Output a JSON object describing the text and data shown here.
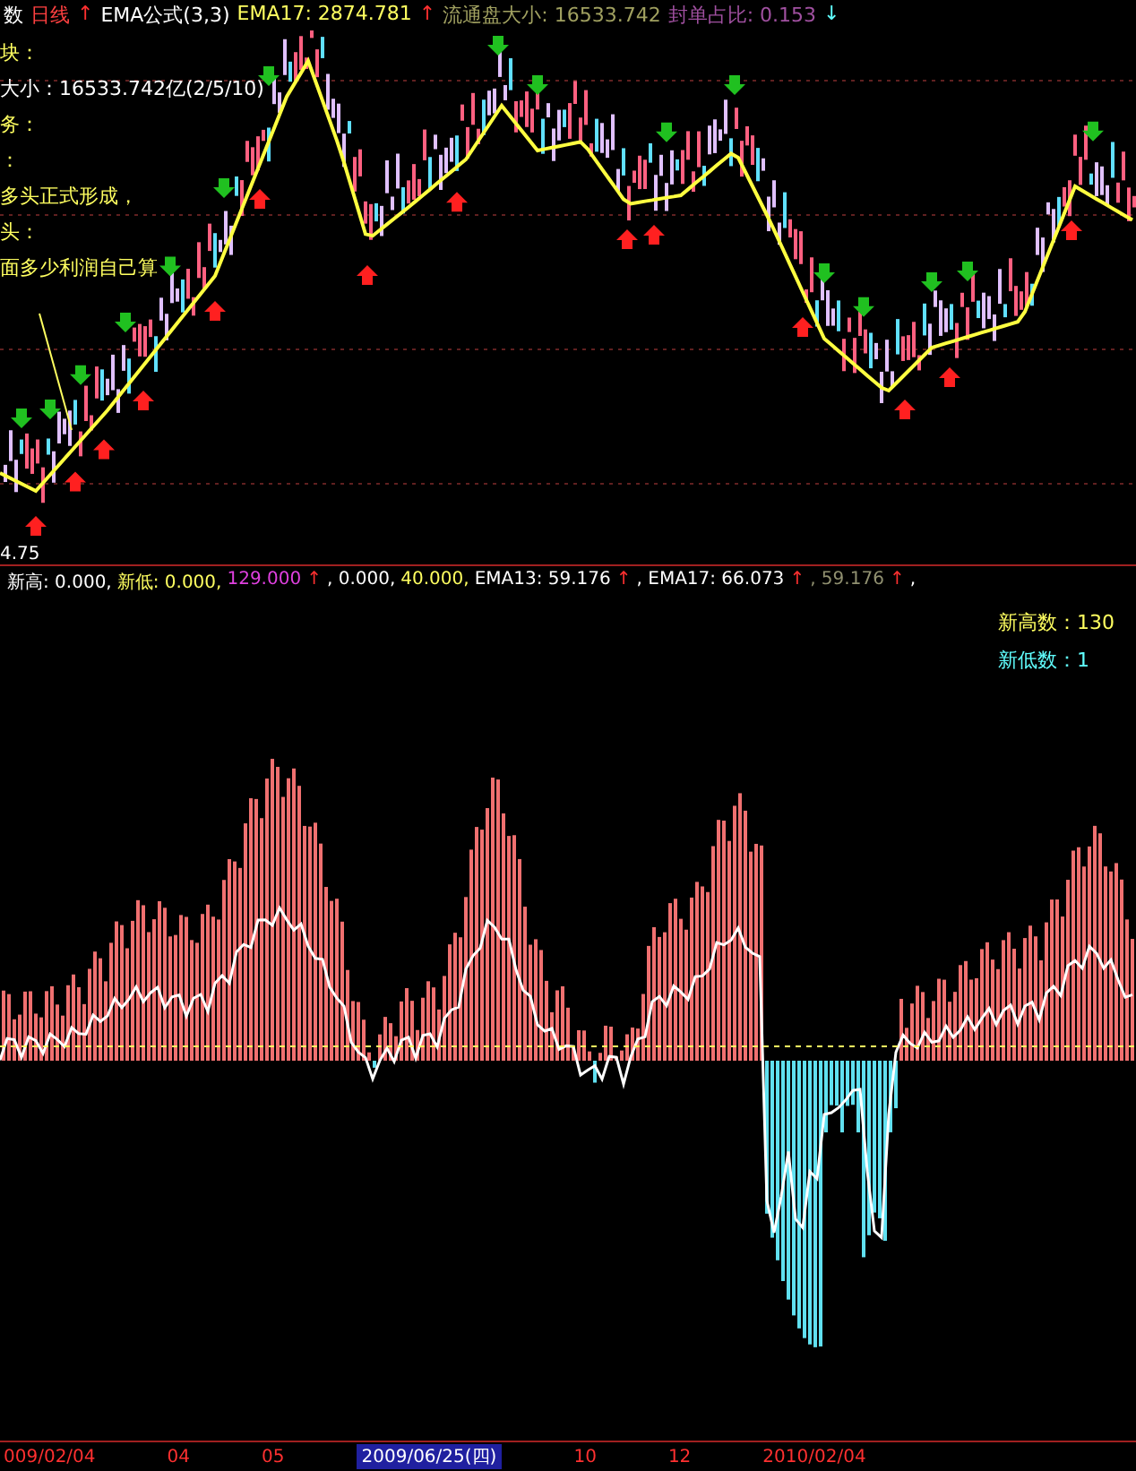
{
  "header": [
    {
      "text": "数",
      "color": "#ffffff"
    },
    {
      "text": "日线",
      "color": "#ff4040"
    },
    {
      "text": "↑",
      "color": "#ff3030"
    },
    {
      "text": "EMA公式(3,3)",
      "color": "#ffffff"
    },
    {
      "text": "EMA17: 2874.781",
      "color": "#ffff60"
    },
    {
      "text": "↑",
      "color": "#ff3030"
    },
    {
      "text": "流通盘大小: 16533.742",
      "color": "#a0a060"
    },
    {
      "text": "封单占比: 0.153",
      "color": "#a050a0"
    },
    {
      "text": "↓",
      "color": "#60ffff"
    }
  ],
  "notes": [
    "块：",
    "大小：16533.742亿(2/5/10)",
    "务：",
    "：",
    "多头正式形成，",
    "头：",
    "面多少利润自己算"
  ],
  "price_axis": "4.75",
  "legend": [
    {
      "text": "新高: 0.000,",
      "color": "#ffffff"
    },
    {
      "text": "新低: 0.000,",
      "color": "#ffff60"
    },
    {
      "text": "129.000",
      "color": "#e040e0"
    },
    {
      "text": "↑",
      "color": "#ff3030"
    },
    {
      "text": ", 0.000,",
      "color": "#ffffff"
    },
    {
      "text": "40.000,",
      "color": "#ffff60"
    },
    {
      "text": "EMA13: 59.176",
      "color": "#ffffff"
    },
    {
      "text": "↑",
      "color": "#ff3030"
    },
    {
      "text": ", EMA17: 66.073",
      "color": "#ffffff"
    },
    {
      "text": "↑",
      "color": "#ff3030"
    },
    {
      "text": ", 59.176",
      "color": "#909070"
    },
    {
      "text": "↑",
      "color": "#ff3030"
    },
    {
      "text": ",",
      "color": "#ffffff"
    }
  ],
  "counts": [
    {
      "text": "新高数：130",
      "color": "#ffff60"
    },
    {
      "text": "新低数：1",
      "color": "#60ffff"
    }
  ],
  "dates": [
    {
      "text": "009/02/04",
      "selected": false
    },
    {
      "text": "04",
      "selected": false
    },
    {
      "text": "05",
      "selected": false
    },
    {
      "text": "2009/06/25(四)",
      "selected": true
    },
    {
      "text": "10",
      "selected": false
    },
    {
      "text": "12",
      "selected": false
    },
    {
      "text": "2010/02/04",
      "selected": false
    }
  ]
}
